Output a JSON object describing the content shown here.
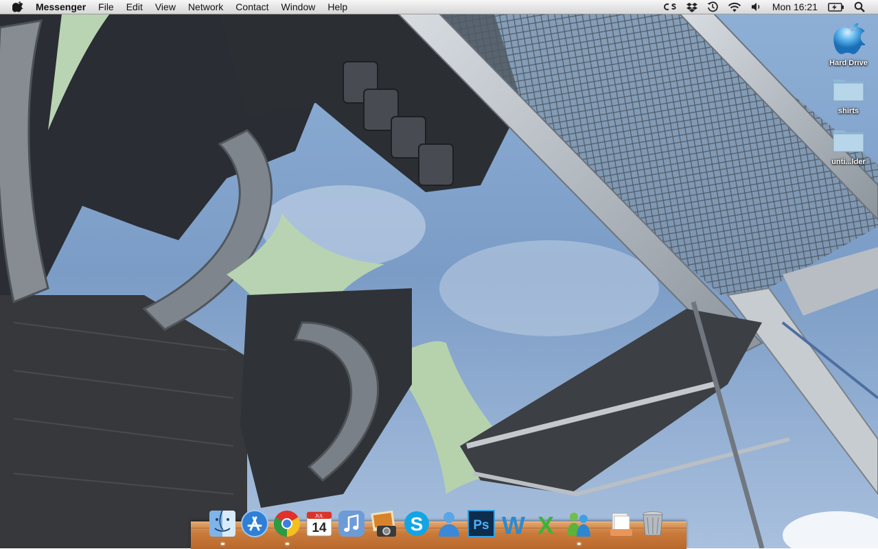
{
  "menubar": {
    "app_name": "Messenger",
    "menus": [
      "File",
      "Edit",
      "View",
      "Network",
      "Contact",
      "Window",
      "Help"
    ],
    "status_icons": [
      "cs5-icon",
      "dropbox-icon",
      "time-machine-icon",
      "wifi-icon",
      "volume-icon"
    ],
    "clock": "Mon 16:21",
    "right_icons": [
      "battery-icon",
      "spotlight-icon"
    ]
  },
  "desktop_icons": [
    {
      "label": "Hard Drive",
      "icon": "hard-drive-icon"
    },
    {
      "label": "shirts",
      "icon": "folder-icon"
    },
    {
      "label": "unti...lder",
      "icon": "folder-icon"
    }
  ],
  "dock": {
    "apps": [
      {
        "name": "finder",
        "icon": "finder-icon",
        "running": true
      },
      {
        "name": "app-store",
        "icon": "app-store-icon",
        "running": false
      },
      {
        "name": "chrome",
        "icon": "chrome-icon",
        "running": true
      },
      {
        "name": "ical",
        "icon": "calendar-icon",
        "running": false,
        "day": "14",
        "month": "JUL"
      },
      {
        "name": "itunes",
        "icon": "itunes-icon",
        "running": false
      },
      {
        "name": "iphoto",
        "icon": "iphoto-icon",
        "running": false
      },
      {
        "name": "skype",
        "icon": "skype-icon",
        "running": false
      },
      {
        "name": "ichat",
        "icon": "ichat-icon",
        "running": false
      },
      {
        "name": "photoshop",
        "icon": "photoshop-icon",
        "running": false,
        "text": "Ps"
      },
      {
        "name": "word",
        "icon": "word-icon",
        "running": false,
        "text": "W"
      },
      {
        "name": "excel",
        "icon": "excel-icon",
        "running": false,
        "text": "X"
      },
      {
        "name": "messenger",
        "icon": "messenger-icon",
        "running": true
      }
    ],
    "right": [
      {
        "name": "documents",
        "icon": "documents-stack-icon"
      },
      {
        "name": "trash",
        "icon": "trash-icon"
      }
    ]
  },
  "colors": {
    "sky": "#7d9fc8",
    "tent": "#b7d3b1",
    "dock_wood": "#c97b3c",
    "menubar": "#e4e4e4"
  }
}
